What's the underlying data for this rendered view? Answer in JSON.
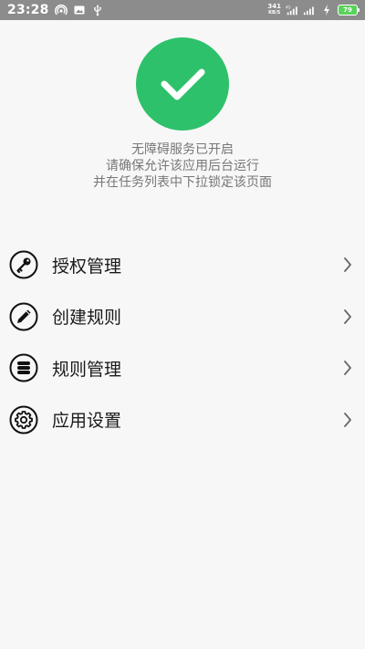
{
  "status_bar": {
    "time": "23:28",
    "net_speed_value": "341",
    "net_speed_unit": "KB/S",
    "battery_level": "79",
    "bg_color": "#8c8c8c"
  },
  "hero": {
    "status_icon": "check-circle-icon",
    "status_color": "#2ec16b",
    "line1": "无障碍服务已开启",
    "line2": "请确保允许该应用后台运行",
    "line3": "并在任务列表中下拉锁定该页面"
  },
  "menu": {
    "items": [
      {
        "label": "授权管理",
        "icon": "key-icon"
      },
      {
        "label": "创建规则",
        "icon": "pencil-icon"
      },
      {
        "label": "规则管理",
        "icon": "database-icon"
      },
      {
        "label": "应用设置",
        "icon": "gear-icon"
      }
    ]
  }
}
